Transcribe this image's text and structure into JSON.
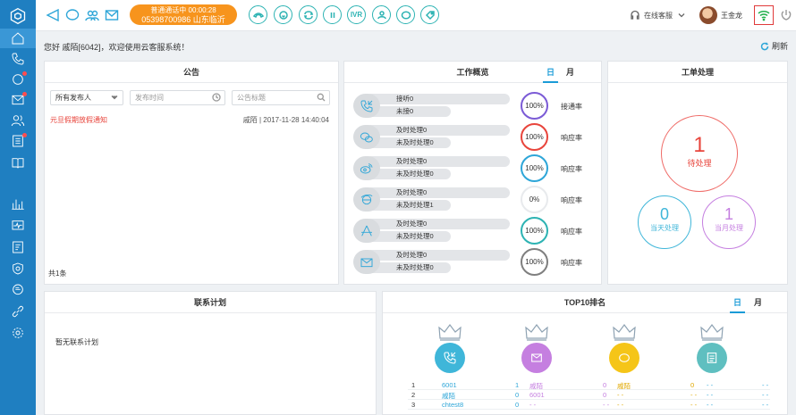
{
  "sidebar": {
    "items": [
      {
        "icon": "home-icon"
      },
      {
        "icon": "phone-icon"
      },
      {
        "icon": "chat-icon"
      },
      {
        "icon": "mail-icon"
      },
      {
        "icon": "contacts-icon"
      },
      {
        "icon": "list-icon"
      },
      {
        "icon": "book-icon"
      },
      {
        "icon": "bar-chart-icon"
      },
      {
        "icon": "monitor-icon"
      },
      {
        "icon": "report-icon"
      },
      {
        "icon": "shield-icon"
      },
      {
        "icon": "message-icon"
      },
      {
        "icon": "link-icon"
      },
      {
        "icon": "settings-icon"
      }
    ]
  },
  "topbar": {
    "call_status_line1": "普通通话中 00:00:28",
    "call_status_line2": "05398700986 山东临沂",
    "ivr_label": "IVR",
    "agent_status": "在线客服",
    "user_name": "王金龙"
  },
  "greeting": "您好 戚陌[6042]，欢迎使用云客服系统！",
  "refresh_label": "刷新",
  "announcements": {
    "title": "公告",
    "publisher_select": "所有发布人",
    "date_placeholder": "发布时间",
    "search_placeholder": "公告标题",
    "items": [
      {
        "title": "元旦假期放假通知",
        "meta": "戚陌 | 2017-11-28 14:40:04"
      }
    ],
    "count": "共1条"
  },
  "overview": {
    "title": "工作概览",
    "tab_day": "日",
    "tab_month": "月",
    "rows": [
      {
        "icon": "phone-in-icon",
        "line1": "接听0",
        "line2": "未接0",
        "rate": "100%",
        "rate_label": "接通率",
        "color": "#7b5bd6"
      },
      {
        "icon": "wechat-icon",
        "line1": "及时处理0",
        "line2": "未及时处理0",
        "rate": "100%",
        "rate_label": "响应率",
        "color": "#e8453c"
      },
      {
        "icon": "weibo-icon",
        "line1": "及时处理0",
        "line2": "未及时处理0",
        "rate": "100%",
        "rate_label": "响应率",
        "color": "#2ea6d8"
      },
      {
        "icon": "ie-icon",
        "line1": "及时处理0",
        "line2": "未及时处理1",
        "rate": "0%",
        "rate_label": "响应率",
        "color": "#e8eaed"
      },
      {
        "icon": "appstore-icon",
        "line1": "及时处理0",
        "line2": "未及时处理0",
        "rate": "100%",
        "rate_label": "响应率",
        "color": "#2db3b3"
      },
      {
        "icon": "email-icon",
        "line1": "及时处理0",
        "line2": "未及时处理0",
        "rate": "100%",
        "rate_label": "响应率",
        "color": "#7f7f7f"
      }
    ]
  },
  "tickets": {
    "title": "工单处理",
    "pending_num": "1",
    "pending_label": "待处理",
    "today_num": "0",
    "today_label": "当天处理",
    "month_num": "1",
    "month_label": "当月处理",
    "colors": {
      "pending": "#ef6b67",
      "today": "#3fb6d9",
      "month": "#c57fe0"
    }
  },
  "plan": {
    "title": "联系计划",
    "empty": "暂无联系计划"
  },
  "top10": {
    "title": "TOP10排名",
    "tab_day": "日",
    "tab_month": "月",
    "columns": [
      {
        "icon": "phone-in-icon",
        "color": "#3fb6d9",
        "crown": "#8fa3b3"
      },
      {
        "icon": "mail-icon",
        "color": "#c57fe0",
        "crown": "#8fa3b3"
      },
      {
        "icon": "chat-icon",
        "color": "#f5c518",
        "crown": "#8fa3b3"
      },
      {
        "icon": "list-icon",
        "color": "#5fbfc0",
        "crown": "#8fa3b3"
      }
    ],
    "rows": [
      {
        "rank": "1",
        "c1_name": "6001",
        "c1_val": "1",
        "c2_name": "戚陌",
        "c2_val": "0",
        "c3_name": "戚陌",
        "c3_val": "0",
        "c4_name": "- -",
        "c4_val": "- -"
      },
      {
        "rank": "2",
        "c1_name": "戚陌",
        "c1_val": "0",
        "c2_name": "6001",
        "c2_val": "0",
        "c3_name": "- -",
        "c3_val": "- -",
        "c4_name": "- -",
        "c4_val": "- -"
      },
      {
        "rank": "3",
        "c1_name": "chtest8",
        "c1_val": "0",
        "c2_name": "- -",
        "c2_val": "- -",
        "c3_name": "- -",
        "c3_val": "- -",
        "c4_name": "- -",
        "c4_val": "- -"
      }
    ]
  }
}
